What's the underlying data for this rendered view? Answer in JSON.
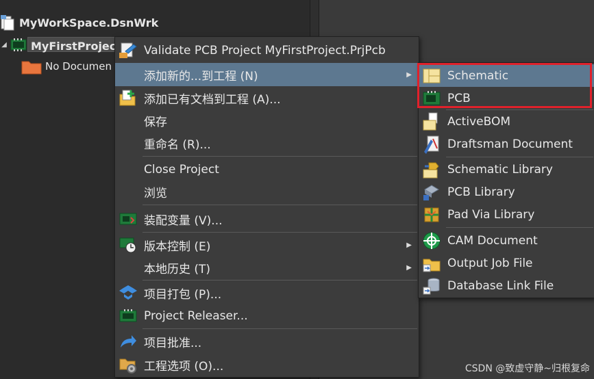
{
  "tree": {
    "workspace": "MyWorkSpace.DsnWrk",
    "project": "MyFirstProject.",
    "no_documents": "No Documen"
  },
  "context_menu": {
    "items": [
      {
        "label": "Validate PCB Project MyFirstProject.PrjPcb",
        "icon": "validate-icon"
      },
      {
        "label": "添加新的...到工程 (N)",
        "icon": "",
        "submenu": true,
        "highlighted": true
      },
      {
        "label": "添加已有文档到工程 (A)...",
        "icon": "add-existing-icon"
      },
      {
        "label": "保存",
        "icon": ""
      },
      {
        "label": "重命名 (R)...",
        "icon": ""
      },
      {
        "label": "Close Project",
        "icon": ""
      },
      {
        "label": "浏览",
        "icon": ""
      },
      {
        "label": "装配变量 (V)...",
        "icon": "assembly-variants-icon"
      },
      {
        "label": "版本控制 (E)",
        "icon": "version-control-icon",
        "submenu": true
      },
      {
        "label": "本地历史 (T)",
        "icon": "",
        "submenu": true
      },
      {
        "label": "项目打包 (P)...",
        "icon": "project-packager-icon"
      },
      {
        "label": "Project Releaser...",
        "icon": "project-releaser-icon"
      },
      {
        "label": "项目批准...",
        "icon": "project-approve-icon"
      },
      {
        "label": "工程选项 (O)...",
        "icon": "project-options-icon"
      }
    ]
  },
  "submenu": {
    "items": [
      {
        "label": "Schematic",
        "icon": "schematic-icon",
        "highlighted": true
      },
      {
        "label": "PCB",
        "icon": "pcb-icon"
      },
      {
        "label": "ActiveBOM",
        "icon": "activebom-icon"
      },
      {
        "label": "Draftsman Document",
        "icon": "draftsman-icon"
      },
      {
        "label": "Schematic Library",
        "icon": "schematic-library-icon"
      },
      {
        "label": "PCB Library",
        "icon": "pcb-library-icon"
      },
      {
        "label": "Pad Via Library",
        "icon": "pad-via-library-icon"
      },
      {
        "label": "CAM Document",
        "icon": "cam-document-icon"
      },
      {
        "label": "Output Job File",
        "icon": "output-job-icon"
      },
      {
        "label": "Database Link File",
        "icon": "database-link-icon"
      }
    ]
  },
  "watermark": "CSDN @致虚守静~归根复命",
  "colors": {
    "highlight": "#5d7890",
    "annotation_box": "#e0212b",
    "menu_bg": "#3c3c3c"
  }
}
